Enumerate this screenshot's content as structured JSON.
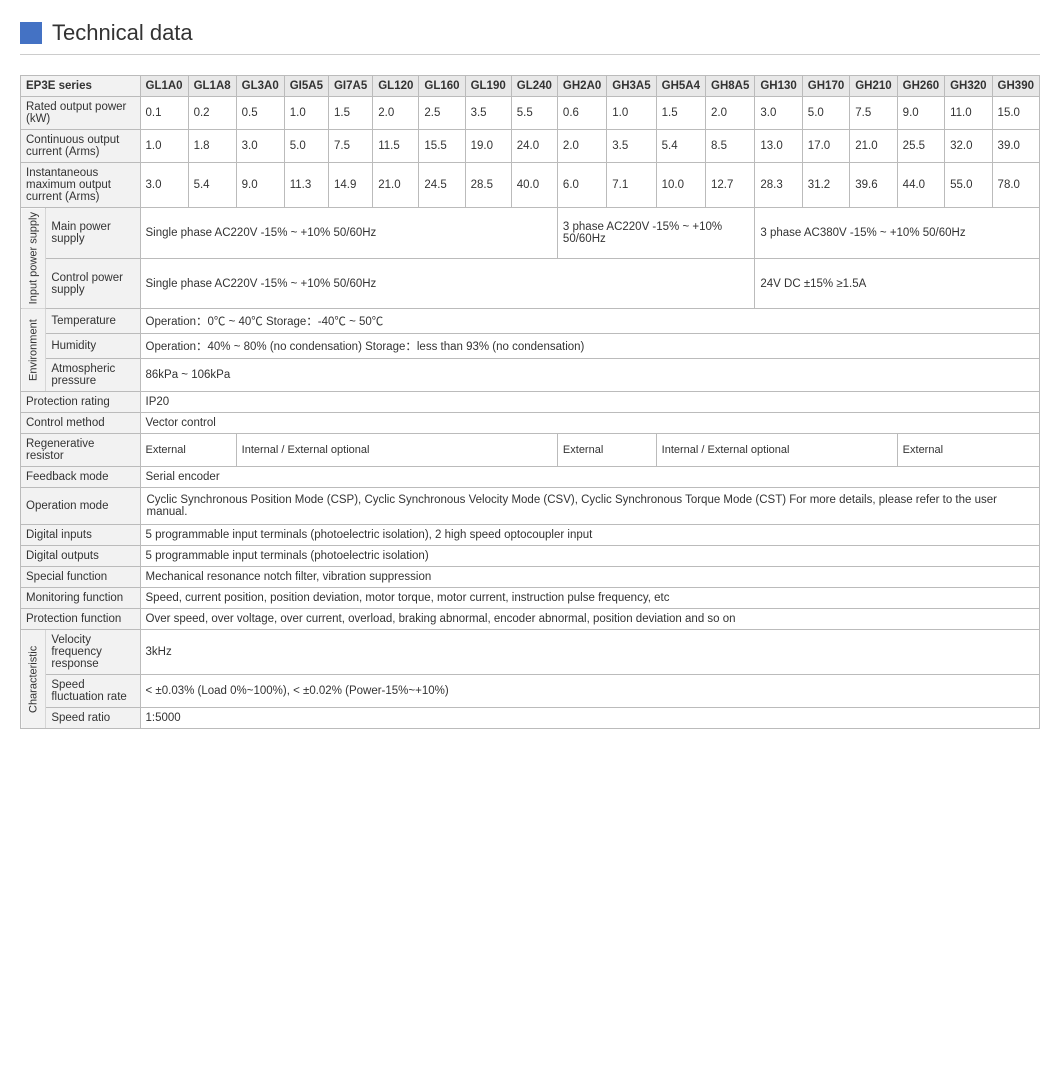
{
  "header": {
    "title": "Technical data"
  },
  "table": {
    "series_label": "EP3E series",
    "columns": [
      "GL1A0",
      "GL1A8",
      "GL3A0",
      "GI5A5",
      "GI7A5",
      "GL120",
      "GL160",
      "GL190",
      "GL240",
      "GH2A0",
      "GH3A5",
      "GH5A4",
      "GH8A5",
      "GH130",
      "GH170",
      "GH210",
      "GH260",
      "GH320",
      "GH390"
    ],
    "rows": {
      "rated_output_power": {
        "label": "Rated output power (kW)",
        "values": [
          "0.1",
          "0.2",
          "0.5",
          "1.0",
          "1.5",
          "2.0",
          "2.5",
          "3.5",
          "5.5",
          "0.6",
          "1.0",
          "1.5",
          "2.0",
          "3.0",
          "5.0",
          "7.5",
          "9.0",
          "11.0",
          "15.0"
        ]
      },
      "continuous_output_current": {
        "label": "Continuous output current (Arms)",
        "values": [
          "1.0",
          "1.8",
          "3.0",
          "5.0",
          "7.5",
          "11.5",
          "15.5",
          "19.0",
          "24.0",
          "2.0",
          "3.5",
          "5.4",
          "8.5",
          "13.0",
          "17.0",
          "21.0",
          "25.5",
          "32.0",
          "39.0"
        ]
      },
      "instantaneous_max_current": {
        "label": "Instantaneous maximum output current (Arms)",
        "values": [
          "3.0",
          "5.4",
          "9.0",
          "11.3",
          "14.9",
          "21.0",
          "24.5",
          "28.5",
          "40.0",
          "6.0",
          "7.1",
          "10.0",
          "12.7",
          "28.3",
          "31.2",
          "39.6",
          "44.0",
          "55.0",
          "78.0"
        ]
      }
    },
    "input_power_supply": {
      "section_label": "Input power supply",
      "main_power": {
        "label": "Main power supply",
        "col1": "Single phase AC220V -15% ~ +10% 50/60Hz",
        "col2": "3 phase AC220V -15% ~ +10%  50/60Hz",
        "col3": "3 phase AC380V -15% ~ +10%  50/60Hz"
      },
      "control_power": {
        "label": "Control power supply",
        "col1": "Single phase    AC220V   -15%  ~ +10%   50/60Hz",
        "col2": "24V DC    ±15%  ≥1.5A"
      }
    },
    "environment": {
      "section_label": "Environment",
      "temperature": {
        "label": "Temperature",
        "value": "Operation：0℃ ~ 40℃          Storage：-40℃ ~ 50℃"
      },
      "humidity": {
        "label": "Humidity",
        "value": "Operation：40%  ~ 80%  (no condensation)          Storage：less than 93% (no condensation)"
      },
      "atmospheric": {
        "label": "Atmospheric pressure",
        "value": "86kPa  ~ 106kPa"
      }
    },
    "protection_rating": {
      "label": "Protection rating",
      "value": "IP20"
    },
    "control_method": {
      "label": "Control method",
      "value": "Vector control"
    },
    "regenerative_resistor": {
      "label": "Regenerative resistor",
      "cells": [
        {
          "text": "External",
          "colspan": 1
        },
        {
          "text": "Internal / External optional",
          "colspan": 1
        },
        {
          "text": "External",
          "colspan": 1
        },
        {
          "text": "Internal / External optional",
          "colspan": 1
        },
        {
          "text": "External",
          "colspan": 1
        }
      ]
    },
    "feedback_mode": {
      "label": "Feedback mode",
      "value": "Serial encoder"
    },
    "operation_mode": {
      "label": "Operation mode",
      "value": "Cyclic Synchronous Position Mode (CSP), Cyclic Synchronous Velocity Mode (CSV), Cyclic Synchronous Torque Mode (CST) For more details, please refer to  the user manual."
    },
    "digital_inputs": {
      "label": "Digital inputs",
      "value": "5 programmable input terminals (photoelectric isolation), 2 high speed optocoupler input"
    },
    "digital_outputs": {
      "label": "Digital outputs",
      "value": "5 programmable input terminals (photoelectric isolation)"
    },
    "special_function": {
      "label": "Special function",
      "value": "Mechanical resonance notch filter, vibration suppression"
    },
    "monitoring_function": {
      "label": "Monitoring function",
      "value": "Speed, current position, position deviation, motor torque, motor current, instruction pulse frequency, etc"
    },
    "protection_function": {
      "label": "Protection function",
      "value": "Over speed, over voltage, over current, overload, braking abnormal, encoder abnormal, position deviation and so on"
    },
    "characteristic": {
      "section_label": "Characteristic",
      "velocity_frequency": {
        "label": "Velocity frequency response",
        "value": "3kHz"
      },
      "speed_fluctuation": {
        "label": "Speed fluctuation rate",
        "value": "< ±0.03% (Load 0%~100%),   < ±0.02% (Power-15%~+10%)"
      },
      "speed_ratio": {
        "label": "Speed ratio",
        "value": "1:5000"
      }
    }
  }
}
